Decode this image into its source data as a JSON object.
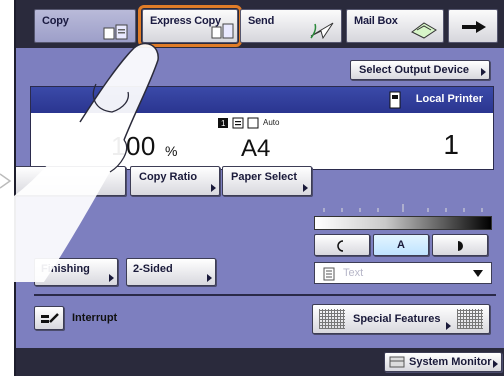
{
  "tabs": [
    {
      "label": "Copy",
      "icon": "copy-icon"
    },
    {
      "label": "Express Copy",
      "icon": "express-copy-icon"
    },
    {
      "label": "Send",
      "icon": "send-icon"
    },
    {
      "label": "Mail Box",
      "icon": "mailbox-icon"
    },
    {
      "icon": "arrow-right-icon"
    }
  ],
  "toolbar": {
    "select_output_label": "Select Output Device"
  },
  "status": {
    "printer": "Local Printer",
    "ratio": "100",
    "ratio_unit": "%",
    "paper_size": "A4",
    "paper_mode": "Auto",
    "copy_count": "1"
  },
  "buttons": {
    "copy_ratio": "Copy Ratio",
    "paper_select": "Paper Select",
    "finishing": "Finishing",
    "two_sided": "2-Sided",
    "interrupt": "Interrupt",
    "special_features": "Special Features",
    "system_monitor": "System Monitor"
  },
  "density": {
    "auto_label": "A"
  },
  "original_type": {
    "value": "Text"
  },
  "colors": {
    "screen_bg": "#7d7fbf",
    "header_blue": "#3b4aa8",
    "highlight": "#e07c28",
    "dark_bar": "#2a2a3c"
  }
}
